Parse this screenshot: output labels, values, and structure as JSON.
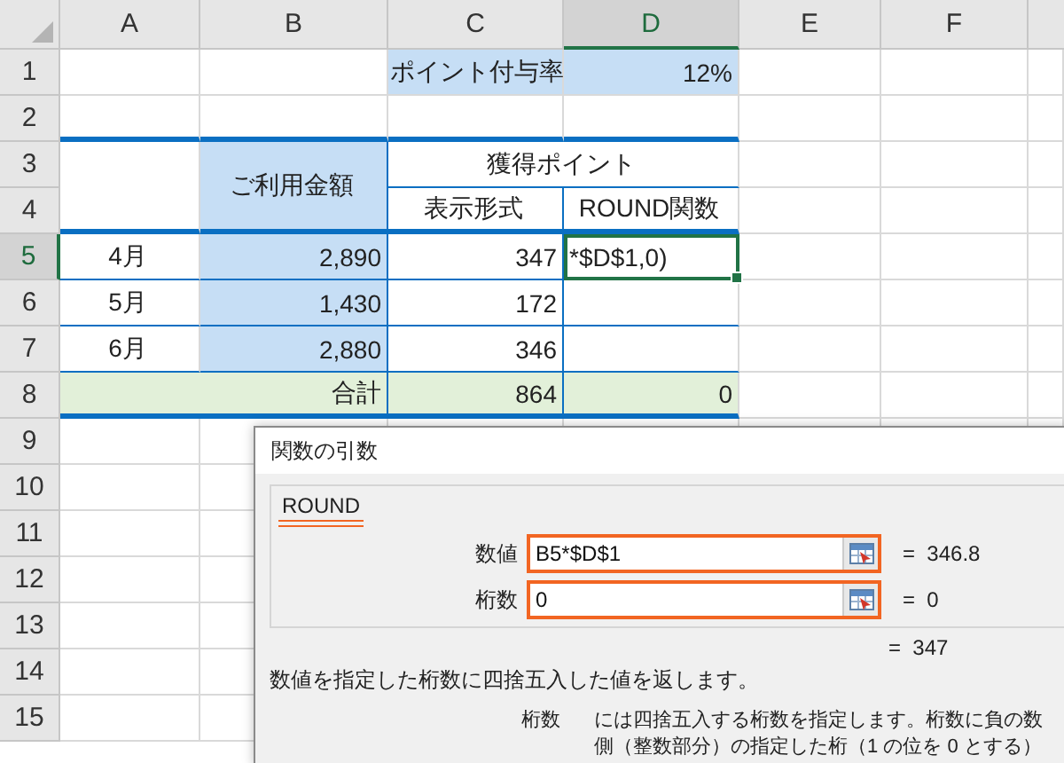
{
  "columns": [
    {
      "label": "A",
      "selected": false
    },
    {
      "label": "B",
      "selected": false
    },
    {
      "label": "C",
      "selected": false
    },
    {
      "label": "D",
      "selected": true
    },
    {
      "label": "E",
      "selected": false
    },
    {
      "label": "F",
      "selected": false
    }
  ],
  "rows": [
    {
      "number": "1",
      "selected": false,
      "cells": [
        "ポイント付与率",
        "12%"
      ]
    },
    {
      "number": "2",
      "selected": false
    },
    {
      "number": "3",
      "selected": false,
      "cells": [
        "ご利用金額",
        "獲得ポイント"
      ]
    },
    {
      "number": "4",
      "selected": false,
      "cells": [
        "表示形式",
        "ROUND関数"
      ]
    },
    {
      "number": "5",
      "selected": true,
      "cells": [
        "4月",
        "2,890",
        "347",
        "*$D$1,0)"
      ]
    },
    {
      "number": "6",
      "selected": false,
      "cells": [
        "5月",
        "1,430",
        "172"
      ]
    },
    {
      "number": "7",
      "selected": false,
      "cells": [
        "6月",
        "2,880",
        "346"
      ]
    },
    {
      "number": "8",
      "selected": false,
      "cells": [
        "合計",
        "864",
        "0"
      ]
    },
    {
      "number": "9",
      "selected": false
    },
    {
      "number": "10",
      "selected": false
    },
    {
      "number": "11",
      "selected": false
    },
    {
      "number": "12",
      "selected": false
    },
    {
      "number": "13",
      "selected": false
    },
    {
      "number": "14",
      "selected": false
    },
    {
      "number": "15",
      "selected": false
    }
  ],
  "dialog": {
    "title": "関数の引数",
    "function_name": "ROUND",
    "arguments": [
      {
        "label": "数値",
        "value": "B5*$D$1",
        "result": "=  346.8"
      },
      {
        "label": "桁数",
        "value": "0",
        "result": "=  0"
      }
    ],
    "result": "=  347",
    "description": "数値を指定した桁数に四捨五入した値を返します。",
    "argument_help": {
      "name": "桁数",
      "lines": [
        "には四捨五入する桁数を指定します。桁数に負の数",
        "側（整数部分）の指定した桁（1 の位を 0 とする）"
      ]
    }
  }
}
